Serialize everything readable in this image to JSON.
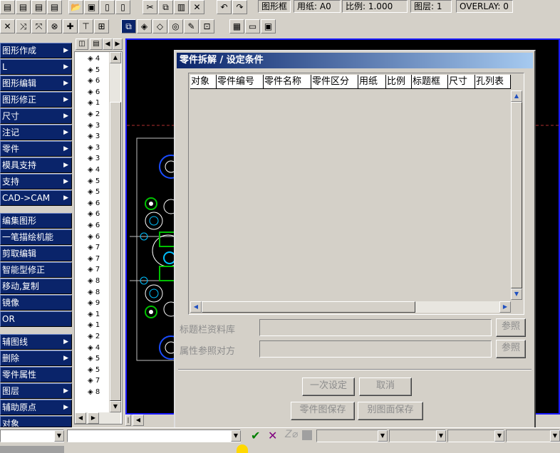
{
  "status_bar_top": {
    "frame": "图形框",
    "paper": "用纸: A0",
    "scale": "比例: 1.000",
    "layer": "图层: 1",
    "overlay": "OVERLAY: 0"
  },
  "menu": {
    "items": [
      {
        "label": "图形作成",
        "arrow": "▶"
      },
      {
        "label": "L",
        "arrow": "▶"
      },
      {
        "label": "图形编辑",
        "arrow": "▶"
      },
      {
        "label": "图形修正",
        "arrow": "▶"
      },
      {
        "label": "尺寸",
        "arrow": "▶"
      },
      {
        "label": "注记",
        "arrow": "▶"
      },
      {
        "label": "零件",
        "arrow": "▶"
      },
      {
        "label": "模具支持",
        "arrow": "▶"
      },
      {
        "label": "支持",
        "arrow": "▶"
      },
      {
        "label": "CAD->CAM",
        "arrow": "▶"
      },
      {
        "label": "编集图形",
        "arrow": ""
      },
      {
        "label": "一笔描绘机能",
        "arrow": ""
      },
      {
        "label": "剪取编辑",
        "arrow": ""
      },
      {
        "label": "智能型修正",
        "arrow": ""
      },
      {
        "label": "移动,复制",
        "arrow": ""
      },
      {
        "label": "镜像",
        "arrow": ""
      },
      {
        "label": "OR",
        "arrow": ""
      },
      {
        "label": "辅图线",
        "arrow": "▶"
      },
      {
        "label": "删除",
        "arrow": "▶"
      },
      {
        "label": "零件属性",
        "arrow": ""
      },
      {
        "label": "图层",
        "arrow": "▶"
      },
      {
        "label": "辅助原点",
        "arrow": "▶"
      },
      {
        "label": "对象",
        "arrow": ""
      }
    ]
  },
  "tree": {
    "rows": [
      "4",
      "5",
      "6",
      "6",
      "1",
      "2",
      "3",
      "3",
      "3",
      "3",
      "4",
      "5",
      "5",
      "6",
      "6",
      "6",
      "6",
      "7",
      "7",
      "7",
      "8",
      "8",
      "9",
      "1",
      "1",
      "2",
      "4",
      "5",
      "5",
      "7",
      "8"
    ]
  },
  "dialog": {
    "title": "零件拆解 / 设定条件",
    "columns": [
      "对象",
      "零件编号",
      "零件名称",
      "零件区分",
      "用纸",
      "比例",
      "标题框",
      "尺寸",
      "孔列表"
    ],
    "title_db_label": "标题栏资料库",
    "attr_ref_label": "属性参照对方",
    "ref_button_1": "参照",
    "ref_button_2": "参照",
    "set_once_button": "一次设定",
    "cancel_button": "取消",
    "save_part_button": "零件图保存",
    "save_separate_button": "别图面保存"
  },
  "colors": {
    "menu_bg": "#0a246a",
    "title_start": "#0a246a",
    "title_end": "#a6caf0",
    "canvas_bg": "#000000",
    "accept_check": "#008000",
    "cancel_x": "#800080"
  }
}
